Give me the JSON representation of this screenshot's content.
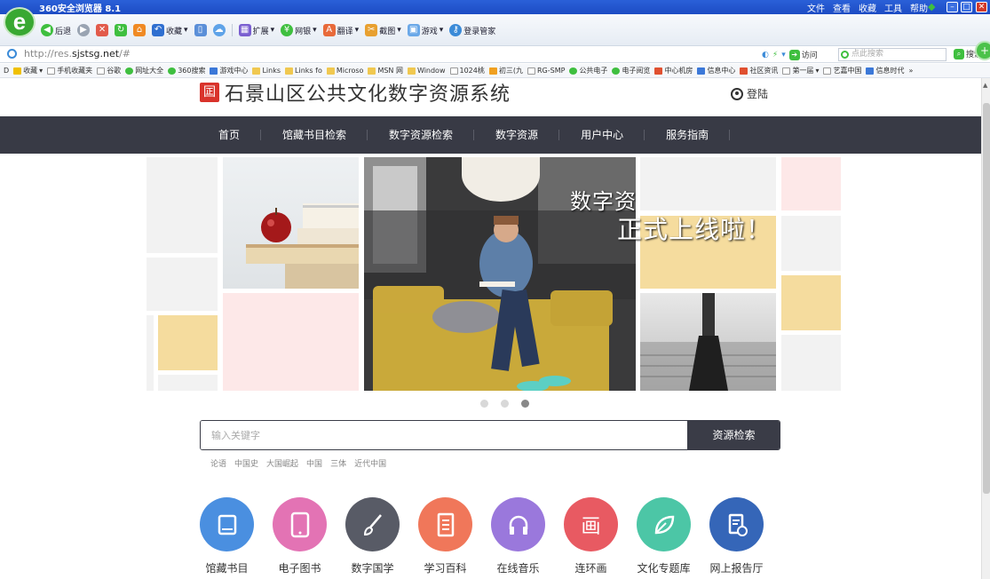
{
  "browser": {
    "window_title": "360安全浏览器 8.1",
    "menus": [
      "文件",
      "查看",
      "收藏",
      "工具",
      "帮助"
    ],
    "toolbar": {
      "back": "后退",
      "favorites": "收藏",
      "extensions": "扩展",
      "netbank": "网银",
      "translate": "翻译",
      "screenshot": "截图",
      "games": "游戏",
      "login_manager": "登录管家"
    },
    "url_prefix": "http://res.",
    "url_domain": "sjstsg.net",
    "url_suffix": "/#",
    "visit": "访问",
    "search_placeholder": "点此搜索",
    "search_button": "搜索",
    "bookmarks": [
      "收藏",
      "手机收藏夹",
      "谷歌",
      "网址大全",
      "360搜索",
      "游戏中心",
      "Links",
      "Links fo",
      "Microso",
      "MSN 网",
      "Window",
      "1024桃",
      "初三(九",
      "RG-SMP",
      "公共电子",
      "电子阅览",
      "中心机房",
      "信息中心",
      "社区资讯",
      "第一届",
      "艺嘉中国",
      "信息时代"
    ]
  },
  "site": {
    "title": "石景山区公共文化数字资源系统",
    "login": "登陆",
    "nav": [
      "首页",
      "馆藏书目检索",
      "数字资源检索",
      "数字资源",
      "用户中心",
      "服务指南"
    ],
    "banner": {
      "line1": "数字资源系统",
      "line2": "正式上线啦！"
    },
    "search": {
      "placeholder": "输入关键字",
      "button": "资源检索"
    },
    "hot_tags": [
      "论语",
      "中国史",
      "大国崛起",
      "中国",
      "三体",
      "近代中国"
    ],
    "categories": [
      {
        "label": "馆藏书目",
        "color": "#4a8fe0",
        "icon": "book-icon"
      },
      {
        "label": "电子图书",
        "color": "#e373b4",
        "icon": "tablet-icon"
      },
      {
        "label": "数字国学",
        "color": "#585b66",
        "icon": "brush-icon"
      },
      {
        "label": "学习百科",
        "color": "#f0775a",
        "icon": "document-icon"
      },
      {
        "label": "在线音乐",
        "color": "#9a78dc",
        "icon": "headphones-icon"
      },
      {
        "label": "连环画",
        "color": "#e85a62",
        "icon": "picture-icon"
      },
      {
        "label": "文化专题库",
        "color": "#4cc6a6",
        "icon": "leaf-icon"
      },
      {
        "label": "网上报告厅",
        "color": "#3566b8",
        "icon": "report-icon"
      }
    ]
  }
}
